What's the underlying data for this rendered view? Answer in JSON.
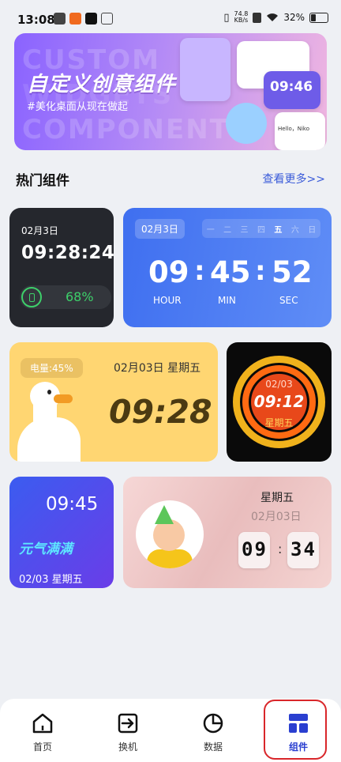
{
  "status": {
    "time": "13:08",
    "net_speed_top": "74.8",
    "net_speed_unit": "KB/s",
    "battery": "32%"
  },
  "banner": {
    "bg_text_1": "CUSTOM",
    "bg_text_2": "WIDGETS",
    "bg_text_3": "COMPONENTS",
    "title": "自定义创意组件",
    "subtitle": "#美化桌面从现在做起",
    "mini_hello": "Hello，Niko",
    "mini_time": "09:46"
  },
  "section": {
    "title": "热门组件",
    "more": "查看更多>>"
  },
  "w1": {
    "date": "02月3日",
    "time": "09:28:24",
    "battery_pct": "68%"
  },
  "w2": {
    "date": "02月3日",
    "weekdays": [
      "一",
      "二",
      "三",
      "四",
      "五",
      "六",
      "日"
    ],
    "active_weekday": "五",
    "hour": "09",
    "min": "45",
    "sec": "52",
    "hour_label": "HOUR",
    "min_label": "MIN",
    "sec_label": "SEC"
  },
  "w3": {
    "power": "电量:45%",
    "date": "02月03日 星期五",
    "time": "09:28"
  },
  "w4": {
    "date": "02/03",
    "time": "09:12",
    "weekday": "星期五"
  },
  "w5": {
    "time": "09:45",
    "tag": "元气满满",
    "date": "02/03 星期五"
  },
  "w6": {
    "weekday": "星期五",
    "date": "02月03日",
    "hour": "09",
    "min": "34"
  },
  "tabs": [
    {
      "label": "首页",
      "icon": "home-icon"
    },
    {
      "label": "换机",
      "icon": "transfer-icon"
    },
    {
      "label": "数据",
      "icon": "pie-chart-icon"
    },
    {
      "label": "组件",
      "icon": "widgets-icon"
    }
  ],
  "colors": {
    "accent": "#2a3fd0",
    "highlight_box": "#d9262a"
  }
}
